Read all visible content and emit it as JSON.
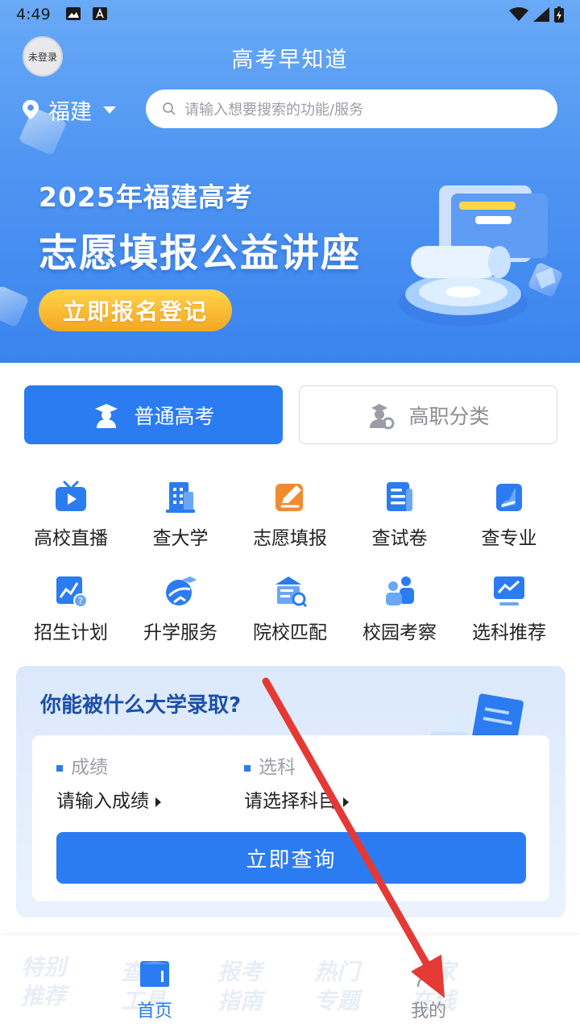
{
  "status_bar": {
    "time": "4:49"
  },
  "header": {
    "avatar_label": "未登录",
    "title": "高考早知道",
    "location": "福建",
    "search_placeholder": "请输入想要搜索的功能/服务"
  },
  "banner": {
    "subtitle": "2025年福建高考",
    "headline": "志愿填报公益讲座",
    "cta_label": "立即报名登记"
  },
  "exam_tabs": [
    {
      "label": "普通高考",
      "active": true
    },
    {
      "label": "高职分类",
      "active": false
    }
  ],
  "features": [
    {
      "label": "高校直播",
      "icon": "tv-play-icon"
    },
    {
      "label": "查大学",
      "icon": "building-icon"
    },
    {
      "label": "志愿填报",
      "icon": "pencil-form-icon"
    },
    {
      "label": "查试卷",
      "icon": "document-icon"
    },
    {
      "label": "查专业",
      "icon": "book-icon"
    },
    {
      "label": "招生计划",
      "icon": "chart-question-icon"
    },
    {
      "label": "升学服务",
      "icon": "graduation-globe-icon"
    },
    {
      "label": "院校匹配",
      "icon": "school-search-icon"
    },
    {
      "label": "校园考察",
      "icon": "people-icon"
    },
    {
      "label": "选科推荐",
      "icon": "trend-monitor-icon"
    }
  ],
  "admission_card": {
    "title": "你能被什么大学录取?",
    "score_label": "成绩",
    "score_value": "请输入成绩",
    "subject_label": "选科",
    "subject_value": "请选择科目",
    "query_label": "立即查询"
  },
  "bottom_nav": {
    "ghost_tabs": [
      "特别\n推荐",
      "查找\n工具",
      "报考\n指南",
      "热门\n专题",
      "专家\n在线"
    ],
    "home_label": "首页",
    "mine_label": "我的"
  },
  "colors": {
    "accent": "#2b7cf0",
    "banner_top": "#69aaf6",
    "cta_gold": "#f5a623",
    "annotation_arrow": "#e53935"
  }
}
